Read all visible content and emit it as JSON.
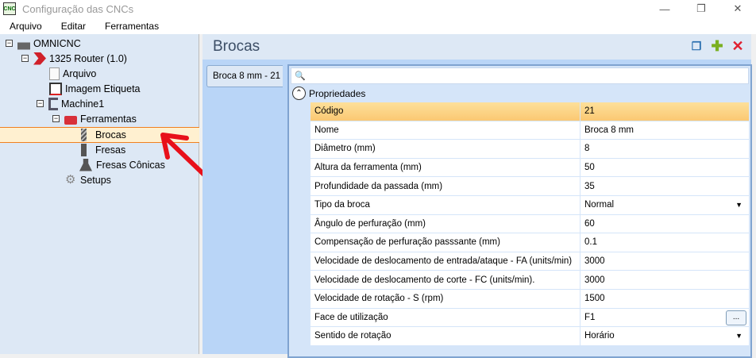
{
  "window": {
    "title": "Configuração das CNCs",
    "app_icon": "CNC",
    "minimize": "—",
    "restore": "❐",
    "close": "✕"
  },
  "menu": [
    "Arquivo",
    "Editar",
    "Ferramentas"
  ],
  "tree": [
    {
      "label": "OMNICNC",
      "icon": "factory-icon",
      "expander": "−"
    },
    {
      "label": "1325 Router (1.0)",
      "icon": "router-chevron-icon",
      "expander": "−"
    },
    {
      "label": "Arquivo",
      "icon": "file-icon"
    },
    {
      "label": "Imagem Etiqueta",
      "icon": "label-image-icon"
    },
    {
      "label": "Machine1",
      "icon": "machine-icon",
      "expander": "−"
    },
    {
      "label": "Ferramentas",
      "icon": "toolbox-icon",
      "expander": "−"
    },
    {
      "label": "Brocas",
      "icon": "drill-bit-icon",
      "selected": true
    },
    {
      "label": "Fresas",
      "icon": "mill-icon"
    },
    {
      "label": "Fresas Cônicas",
      "icon": "conical-mill-icon"
    },
    {
      "label": "Setups",
      "icon": "gear-icon"
    }
  ],
  "panel": {
    "title": "Brocas",
    "tab": "Broca 8 mm - 21",
    "category": "Propriedades",
    "ellipsis": "...",
    "properties": [
      {
        "name": "Código",
        "value": "21"
      },
      {
        "name": "Nome",
        "value": "Broca 8 mm"
      },
      {
        "name": "Diâmetro (mm)",
        "value": "8"
      },
      {
        "name": "Altura da ferramenta (mm)",
        "value": "50"
      },
      {
        "name": "Profundidade da passada (mm)",
        "value": "35"
      },
      {
        "name": "Tipo da broca",
        "value": "Normal"
      },
      {
        "name": "Ângulo de perfuração (mm)",
        "value": "60"
      },
      {
        "name": "Compensação de perfuração passsante (mm)",
        "value": "0.1"
      },
      {
        "name": "Velocidade de deslocamento de entrada/ataque - FA (units/min)",
        "value": "3000"
      },
      {
        "name": "Velocidade de deslocamento de corte - FC (units/min).",
        "value": "3000"
      },
      {
        "name": "Velocidade de rotação - S (rpm)",
        "value": "1500"
      },
      {
        "name": "Face de utilização",
        "value": "F1"
      },
      {
        "name": "Sentido de rotação",
        "value": "Horário"
      }
    ]
  }
}
